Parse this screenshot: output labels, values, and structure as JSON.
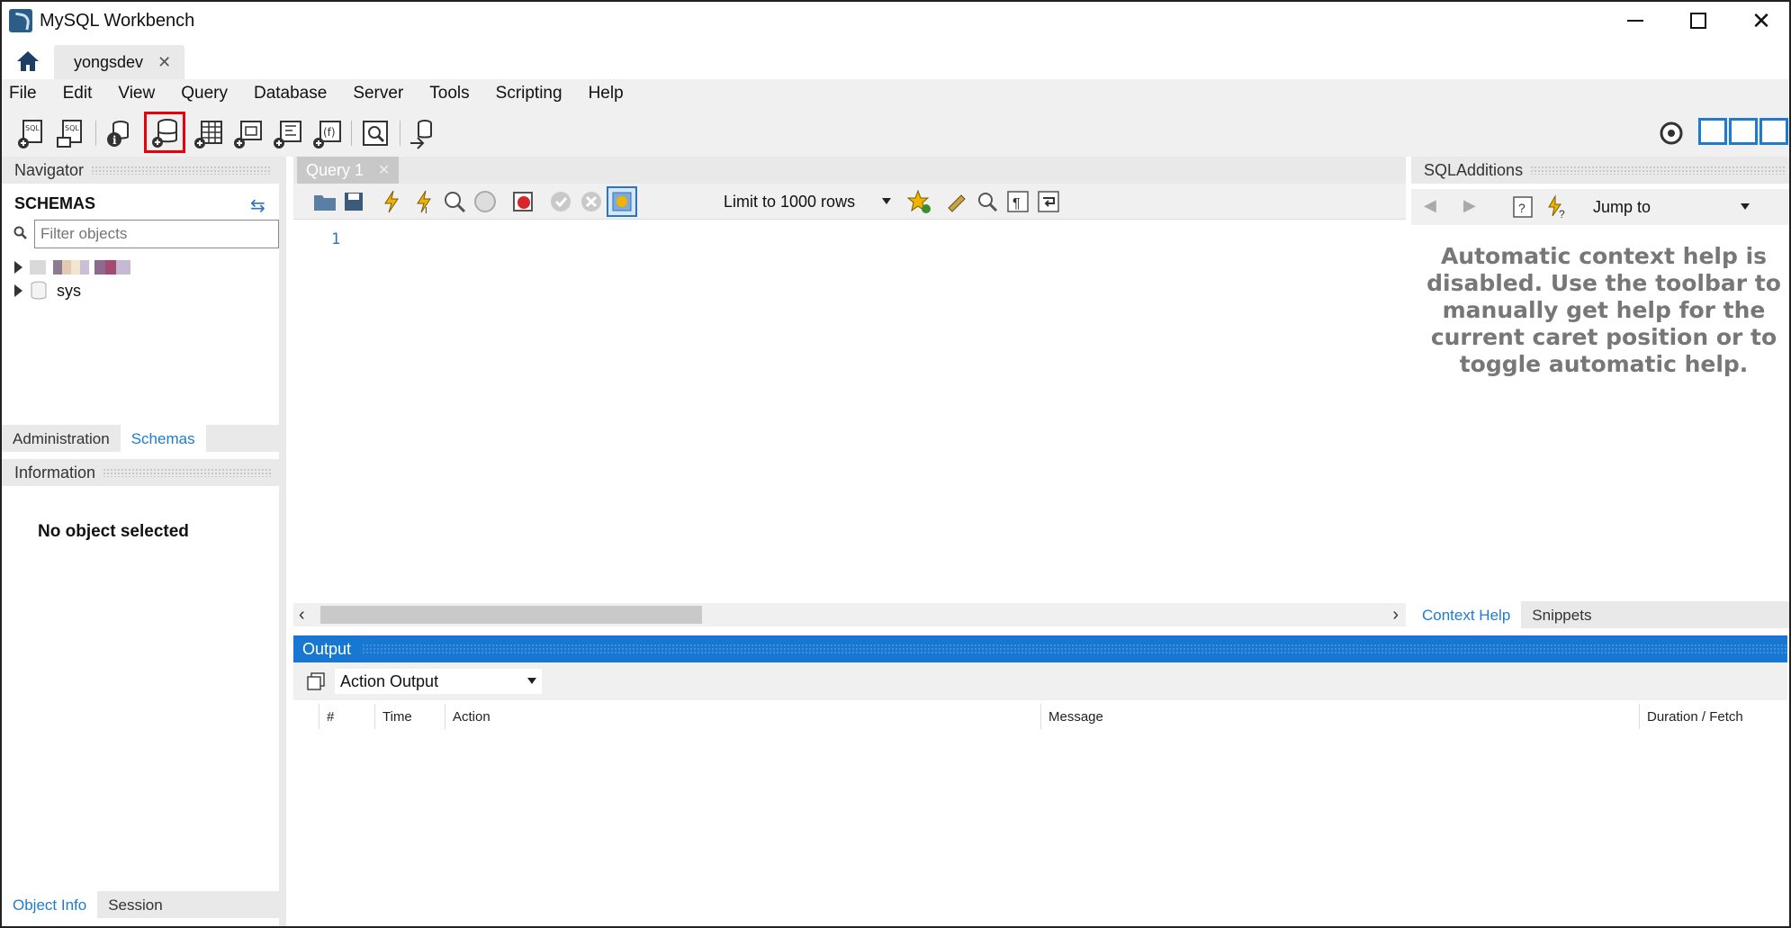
{
  "window": {
    "title": "MySQL Workbench",
    "minimize_label": "—",
    "maximize_label": "",
    "close_label": "✕"
  },
  "tabs": {
    "connection_tab": "yongsdev",
    "close_glyph": "✕"
  },
  "menu": [
    "File",
    "Edit",
    "View",
    "Query",
    "Database",
    "Server",
    "Tools",
    "Scripting",
    "Help"
  ],
  "toolbar": {
    "icons": [
      "new-sql-tab-icon",
      "open-sql-script-icon",
      "inspector-info-icon",
      "create-schema-icon",
      "create-table-icon",
      "create-view-icon",
      "create-procedure-icon",
      "create-function-icon",
      "search-table-data-icon",
      "reconnect-icon"
    ],
    "selected_icon": "create-schema-icon",
    "highlight_color": "#e8000a"
  },
  "navigator": {
    "header": "Navigator",
    "schemas_title": "SCHEMAS",
    "filter_placeholder": "Filter objects",
    "schemas": [
      "sys"
    ],
    "bottom_tabs": [
      "Administration",
      "Schemas"
    ],
    "active_bottom_tab": "Schemas"
  },
  "information": {
    "header": "Information",
    "message": "No object selected",
    "bottom_tabs": [
      "Object Info",
      "Session"
    ],
    "active_bottom_tab": "Object Info"
  },
  "query": {
    "tab_label": "Query 1",
    "tab_close": "✕",
    "limit_label": "Limit to 1000 rows",
    "line_number": "1"
  },
  "sql_additions": {
    "header": "SQLAdditions",
    "jump_to": "Jump to",
    "context_help": "Automatic context help is disabled. Use the toolbar to manually get help for the current caret position or to toggle automatic help.",
    "tabs": [
      "Context Help",
      "Snippets"
    ],
    "active_tab": "Context Help"
  },
  "output": {
    "header": "Output",
    "select_value": "Action Output",
    "columns": [
      "#",
      "Time",
      "Action",
      "Message",
      "Duration / Fetch"
    ]
  },
  "colors": {
    "accent": "#1777d1",
    "link_blue": "#1f7bd0",
    "panel_gray": "#e9e9e9"
  }
}
